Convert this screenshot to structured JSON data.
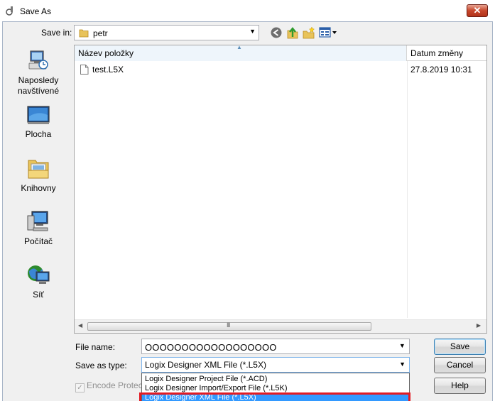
{
  "window": {
    "title": "Save As",
    "close_icon": "close-icon"
  },
  "toolbar": {
    "save_in_label": "Save in:",
    "save_in_value": "petr",
    "icons": [
      "back-arrow-icon",
      "up-folder-icon",
      "new-folder-icon",
      "views-menu-icon"
    ]
  },
  "places": [
    {
      "label": "Naposledy navštívené",
      "icon": "recent-places-icon"
    },
    {
      "label": "Plocha",
      "icon": "desktop-icon"
    },
    {
      "label": "Knihovny",
      "icon": "libraries-icon"
    },
    {
      "label": "Počítač",
      "icon": "computer-icon"
    },
    {
      "label": "Síť",
      "icon": "network-icon"
    }
  ],
  "filelist": {
    "columns": [
      "Název položky",
      "Datum změny"
    ],
    "rows": [
      {
        "name": "test.L5X",
        "date": "27.8.2019 10:31"
      }
    ]
  },
  "form": {
    "file_name_label": "File name:",
    "file_name_value": "OOOOOOOOOOOOOOOOOO",
    "save_type_label": "Save as type:",
    "save_type_value": "Logix Designer XML File (*.L5X)",
    "encode_label": "Encode Protecte",
    "type_options": [
      "Logix Designer Project File (*.ACD)",
      "Logix Designer Import/Export File (*.L5K)",
      "Logix Designer XML File (*.L5X)"
    ],
    "selected_option_index": 2
  },
  "buttons": {
    "save": "Save",
    "cancel": "Cancel",
    "help": "Help"
  },
  "colors": {
    "selection": "#3399ff",
    "highlight_outline": "#e31b23",
    "close_button": "#c7462b"
  }
}
